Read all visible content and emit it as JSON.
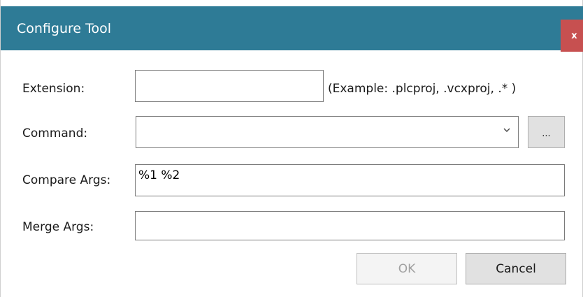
{
  "window": {
    "title": "Configure Tool",
    "close_label": "x",
    "titlebar_color": "#2e7b96",
    "close_color": "#c75050"
  },
  "form": {
    "extension": {
      "label": "Extension:",
      "value": "",
      "hint": "(Example: .plcproj, .vcxproj, .* )"
    },
    "command": {
      "label": "Command:",
      "value": "",
      "browse_label": "..."
    },
    "compare_args": {
      "label": "Compare Args:",
      "value": "%1 %2"
    },
    "merge_args": {
      "label": "Merge Args:",
      "value": ""
    }
  },
  "buttons": {
    "ok_label": "OK",
    "cancel_label": "Cancel"
  }
}
